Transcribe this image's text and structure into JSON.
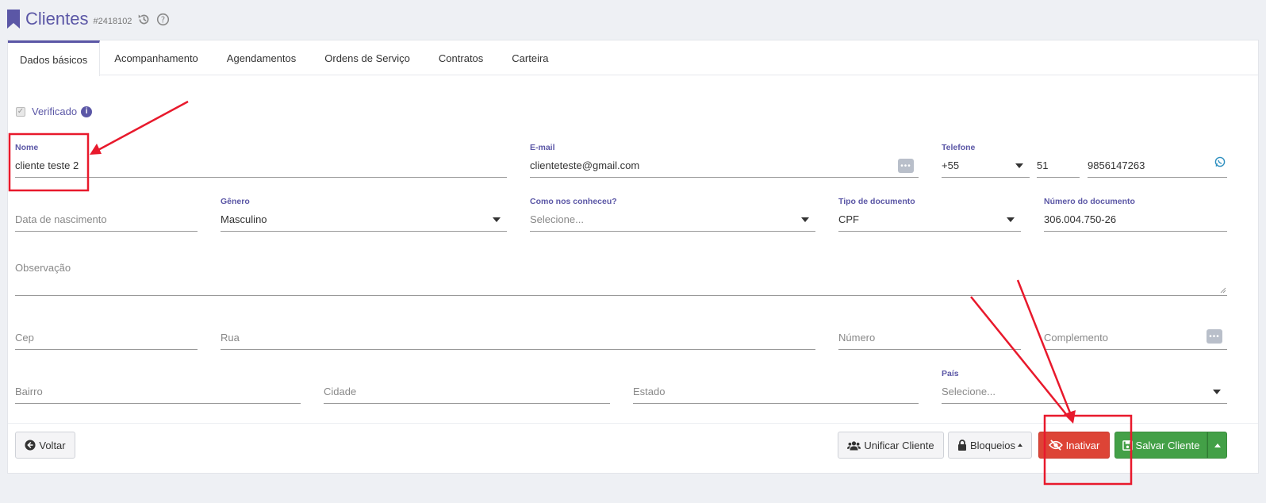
{
  "header": {
    "title": "Clientes",
    "code": "#2418102",
    "history_icon": "history-icon",
    "help_icon": "help-icon"
  },
  "tabs": [
    {
      "label": "Dados básicos",
      "active": true
    },
    {
      "label": "Acompanhamento"
    },
    {
      "label": "Agendamentos"
    },
    {
      "label": "Ordens de Serviço"
    },
    {
      "label": "Contratos"
    },
    {
      "label": "Carteira"
    }
  ],
  "verificado": {
    "label": "Verificado",
    "checked": true
  },
  "fields": {
    "nome": {
      "label": "Nome",
      "value": "cliente teste 2"
    },
    "email": {
      "label": "E-mail",
      "value": "clienteteste@gmail.com"
    },
    "telefone": {
      "label": "Telefone",
      "ddi": "+55",
      "ddd": "51",
      "numero": "9856147263"
    },
    "nascimento": {
      "placeholder": "Data de nascimento"
    },
    "genero": {
      "label": "Gênero",
      "value": "Masculino"
    },
    "como_conheceu": {
      "label": "Como nos conheceu?",
      "placeholder": "Selecione..."
    },
    "tipo_documento": {
      "label": "Tipo de documento",
      "value": "CPF"
    },
    "numero_documento": {
      "label": "Número do documento",
      "value": "306.004.750-26"
    },
    "observacao": {
      "placeholder": "Observação"
    },
    "cep": {
      "placeholder": "Cep"
    },
    "rua": {
      "placeholder": "Rua"
    },
    "numero": {
      "placeholder": "Número"
    },
    "complemento": {
      "placeholder": "Complemento"
    },
    "bairro": {
      "placeholder": "Bairro"
    },
    "cidade": {
      "placeholder": "Cidade"
    },
    "estado": {
      "placeholder": "Estado"
    },
    "pais": {
      "label": "País",
      "placeholder": "Selecione..."
    }
  },
  "buttons": {
    "voltar": "Voltar",
    "unificar": "Unificar Cliente",
    "bloqueios": "Bloqueios",
    "inativar": "Inativar",
    "salvar": "Salvar Cliente"
  },
  "colors": {
    "accent": "#5b57a6",
    "danger": "#dd4436",
    "success": "#43a047",
    "annotation": "#e8192c"
  }
}
